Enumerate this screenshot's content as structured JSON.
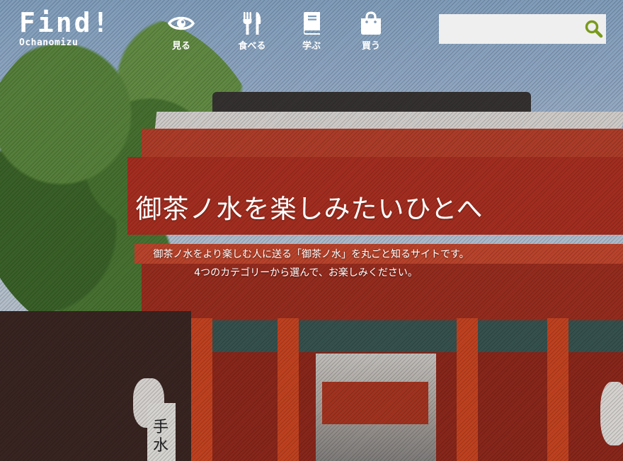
{
  "header": {
    "logo": {
      "title": "Find!",
      "subtitle": "Ochanomizu"
    },
    "nav": [
      {
        "label": "見る",
        "icon": "eye-icon"
      },
      {
        "label": "食べる",
        "icon": "fork-knife-icon"
      },
      {
        "label": "学ぶ",
        "icon": "book-icon"
      },
      {
        "label": "買う",
        "icon": "shopping-bag-icon"
      }
    ],
    "search": {
      "placeholder": "",
      "value": "",
      "icon": "search-icon",
      "accent": "#7a9a1c"
    }
  },
  "hero": {
    "title": "御茶ノ水を楽しみたいひとへ",
    "description_line1": "御茶ノ水をより楽しむ人に送る「御茶ノ水」を丸ごと知るサイトです。",
    "description_line2": "4つのカテゴリーから選んで、お楽しみください。",
    "sign_text": "手水"
  }
}
